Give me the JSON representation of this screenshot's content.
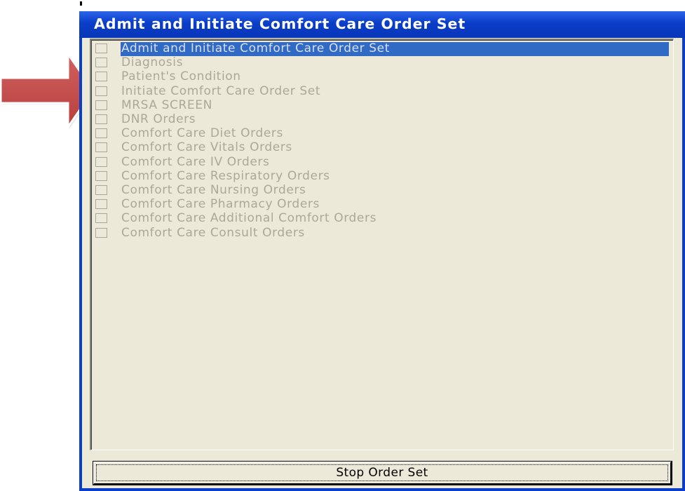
{
  "window": {
    "title": "Admit and Initiate Comfort Care Order Set"
  },
  "order_list": {
    "selected_index": 0,
    "items": [
      {
        "label": "Admit and Initiate Comfort Care Order Set",
        "checked": false
      },
      {
        "label": "Diagnosis",
        "checked": false
      },
      {
        "label": "Patient's Condition",
        "checked": false
      },
      {
        "label": "Initiate Comfort Care Order Set",
        "checked": false
      },
      {
        "label": "MRSA SCREEN",
        "checked": false
      },
      {
        "label": "DNR Orders",
        "checked": false
      },
      {
        "label": "Comfort Care Diet Orders",
        "checked": false
      },
      {
        "label": "Comfort Care Vitals Orders",
        "checked": false
      },
      {
        "label": "Comfort Care IV Orders",
        "checked": false
      },
      {
        "label": "Comfort Care Respiratory Orders",
        "checked": false
      },
      {
        "label": "Comfort Care Nursing Orders",
        "checked": false
      },
      {
        "label": "Comfort Care Pharmacy Orders",
        "checked": false
      },
      {
        "label": "Comfort Care Additional Comfort Orders",
        "checked": false
      },
      {
        "label": "Comfort Care Consult Orders",
        "checked": false
      }
    ]
  },
  "buttons": {
    "stop_label": "Stop Order Set"
  },
  "annotation": {
    "arrow_color": "#c0504d",
    "arrow_icon": "right-arrow-icon"
  },
  "colors": {
    "titlebar": "#0a3dc8",
    "selection": "#316ac5",
    "disabled_text": "#aca899",
    "client_bg": "#ece9d8"
  }
}
